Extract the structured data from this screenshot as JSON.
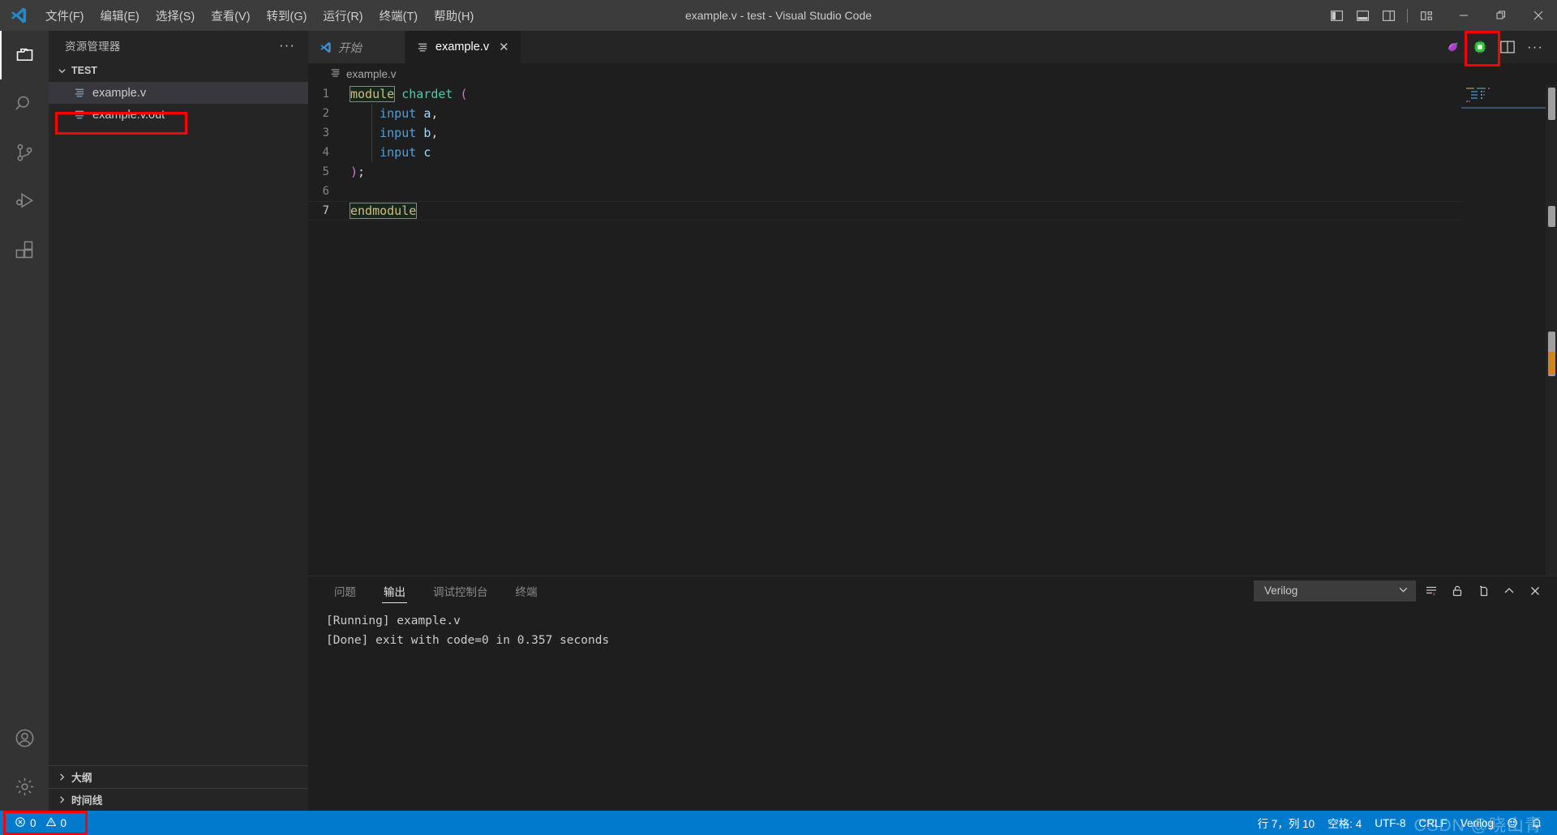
{
  "window": {
    "title": "example.v - test - Visual Studio Code",
    "logo_icon": "vscode-logo-icon"
  },
  "menu": {
    "items": [
      {
        "label": "文件(F)",
        "name": "menu-file"
      },
      {
        "label": "编辑(E)",
        "name": "menu-edit"
      },
      {
        "label": "选择(S)",
        "name": "menu-selection"
      },
      {
        "label": "查看(V)",
        "name": "menu-view"
      },
      {
        "label": "转到(G)",
        "name": "menu-go"
      },
      {
        "label": "运行(R)",
        "name": "menu-run"
      },
      {
        "label": "终端(T)",
        "name": "menu-terminal"
      },
      {
        "label": "帮助(H)",
        "name": "menu-help"
      }
    ]
  },
  "titlebar_right": {
    "layout_buttons": [
      {
        "icon": "toggle-primary-sidebar-icon",
        "tooltip": "切换主侧栏"
      },
      {
        "icon": "toggle-panel-icon",
        "tooltip": "切换面板"
      },
      {
        "icon": "toggle-secondary-sidebar-icon",
        "tooltip": "切换辅助侧栏"
      },
      {
        "icon": "customize-layout-icon",
        "tooltip": "自定义布局"
      }
    ],
    "window_buttons": [
      {
        "icon": "minimize-icon",
        "name": "window-minimize"
      },
      {
        "icon": "restore-icon",
        "name": "window-restore"
      },
      {
        "icon": "close-icon",
        "name": "window-close"
      }
    ]
  },
  "activitybar": {
    "items": [
      {
        "icon": "explorer-icon",
        "name": "activity-explorer",
        "active": true
      },
      {
        "icon": "search-icon",
        "name": "activity-search",
        "active": false
      },
      {
        "icon": "source-control-icon",
        "name": "activity-source-control",
        "active": false
      },
      {
        "icon": "run-debug-icon",
        "name": "activity-run-debug",
        "active": false
      },
      {
        "icon": "extensions-icon",
        "name": "activity-extensions",
        "active": false
      }
    ],
    "bottom": [
      {
        "icon": "account-icon",
        "name": "activity-account"
      },
      {
        "icon": "settings-gear-icon",
        "name": "activity-settings"
      }
    ]
  },
  "sidebar": {
    "title": "资源管理器",
    "more_actions": "···",
    "folder": {
      "label": "TEST",
      "expanded": true
    },
    "files": [
      {
        "label": "example.v",
        "selected": true,
        "annotated": false
      },
      {
        "label": "example.v.out",
        "selected": false,
        "annotated": true
      }
    ],
    "collapsed_sections": [
      {
        "label": "大纲",
        "name": "sidebar-section-outline"
      },
      {
        "label": "时间线",
        "name": "sidebar-section-timeline"
      }
    ]
  },
  "tabs": [
    {
      "label": "开始",
      "icon": "vscode-logo-icon",
      "active": false,
      "preview": true,
      "closable": false
    },
    {
      "label": "example.v",
      "icon": "verilog-file-icon",
      "active": true,
      "preview": false,
      "closable": true,
      "close_glyph": "✕"
    }
  ],
  "editor_actions": [
    {
      "icon": "eggplant-icon",
      "name": "editor-action-eggplant",
      "annotated": false
    },
    {
      "icon": "chip-run-icon",
      "name": "editor-action-run-chip",
      "annotated": true
    },
    {
      "icon": "split-editor-icon",
      "name": "editor-action-split",
      "annotated": false
    },
    {
      "icon": "more-actions-icon",
      "name": "editor-action-more",
      "label": "···",
      "annotated": false
    }
  ],
  "breadcrumb": {
    "file": "example.v",
    "icon": "verilog-file-icon"
  },
  "editor": {
    "language": "Verilog",
    "lines": [
      {
        "no": "1",
        "current": false,
        "tokens": [
          {
            "t": "module",
            "c": "kw-box"
          },
          {
            "t": " ",
            "c": "plain"
          },
          {
            "t": "chardet",
            "c": "mod"
          },
          {
            "t": " ",
            "c": "plain"
          },
          {
            "t": "(",
            "c": "punct"
          }
        ]
      },
      {
        "no": "2",
        "current": false,
        "tokens": [
          {
            "t": "    ",
            "c": "plain"
          },
          {
            "t": "input",
            "c": "type"
          },
          {
            "t": " ",
            "c": "plain"
          },
          {
            "t": "a",
            "c": "var"
          },
          {
            "t": ",",
            "c": "plain"
          }
        ]
      },
      {
        "no": "3",
        "current": false,
        "tokens": [
          {
            "t": "    ",
            "c": "plain"
          },
          {
            "t": "input",
            "c": "type"
          },
          {
            "t": " ",
            "c": "plain"
          },
          {
            "t": "b",
            "c": "var"
          },
          {
            "t": ",",
            "c": "plain"
          }
        ]
      },
      {
        "no": "4",
        "current": false,
        "tokens": [
          {
            "t": "    ",
            "c": "plain"
          },
          {
            "t": "input",
            "c": "type"
          },
          {
            "t": " ",
            "c": "plain"
          },
          {
            "t": "c",
            "c": "var"
          }
        ]
      },
      {
        "no": "5",
        "current": false,
        "tokens": [
          {
            "t": ")",
            "c": "punct"
          },
          {
            "t": ";",
            "c": "plain"
          }
        ]
      },
      {
        "no": "6",
        "current": false,
        "tokens": []
      },
      {
        "no": "7",
        "current": true,
        "tokens": [
          {
            "t": "endmodule",
            "c": "kw-box"
          }
        ]
      }
    ]
  },
  "panel": {
    "tabs": [
      {
        "label": "问题",
        "name": "panel-tab-problems",
        "active": false
      },
      {
        "label": "输出",
        "name": "panel-tab-output",
        "active": true
      },
      {
        "label": "调试控制台",
        "name": "panel-tab-debug-console",
        "active": false
      },
      {
        "label": "终端",
        "name": "panel-tab-terminal",
        "active": false
      }
    ],
    "channel_select": {
      "value": "Verilog",
      "icon": "chevron-down-icon"
    },
    "actions": [
      {
        "icon": "clear-output-icon",
        "name": "panel-clear-output"
      },
      {
        "icon": "lock-icon",
        "name": "panel-turn-auto-scroll-off"
      },
      {
        "icon": "open-in-editor-icon",
        "name": "panel-open-in-editor"
      },
      {
        "icon": "chevron-up-icon",
        "name": "panel-maximize"
      },
      {
        "icon": "close-icon",
        "name": "panel-close"
      }
    ],
    "output_lines": [
      "[Running] example.v",
      "[Done] exit with code=0 in 0.357 seconds"
    ]
  },
  "statusbar": {
    "left": [
      {
        "label": "0",
        "icon": "error-icon",
        "name": "status-errors"
      },
      {
        "label": "0",
        "icon": "warning-icon",
        "name": "status-warnings"
      }
    ],
    "right": [
      {
        "label": "行 7，列 10",
        "name": "status-cursor-position"
      },
      {
        "label": "空格: 4",
        "name": "status-indentation"
      },
      {
        "label": "UTF-8",
        "name": "status-encoding"
      },
      {
        "label": "CRLF",
        "name": "status-eol"
      },
      {
        "label": "Verilog",
        "name": "status-language-mode"
      },
      {
        "label": "",
        "icon": "feedback-smiley-icon",
        "name": "status-feedback"
      },
      {
        "label": "",
        "icon": "bell-icon",
        "name": "status-notifications"
      }
    ],
    "watermark": "CSDN @晓山青"
  },
  "colors": {
    "accent": "#007acc",
    "titlebar_bg": "#3c3c3c",
    "sidebar_bg": "#252526",
    "editor_bg": "#1e1e1e",
    "annotation_red": "#ff0000",
    "keyword": "#d7ba7d",
    "module_name": "#4ec9b0",
    "type_blue": "#569cd6",
    "variable": "#9cdcfe",
    "punct_magenta": "#da70d6"
  }
}
